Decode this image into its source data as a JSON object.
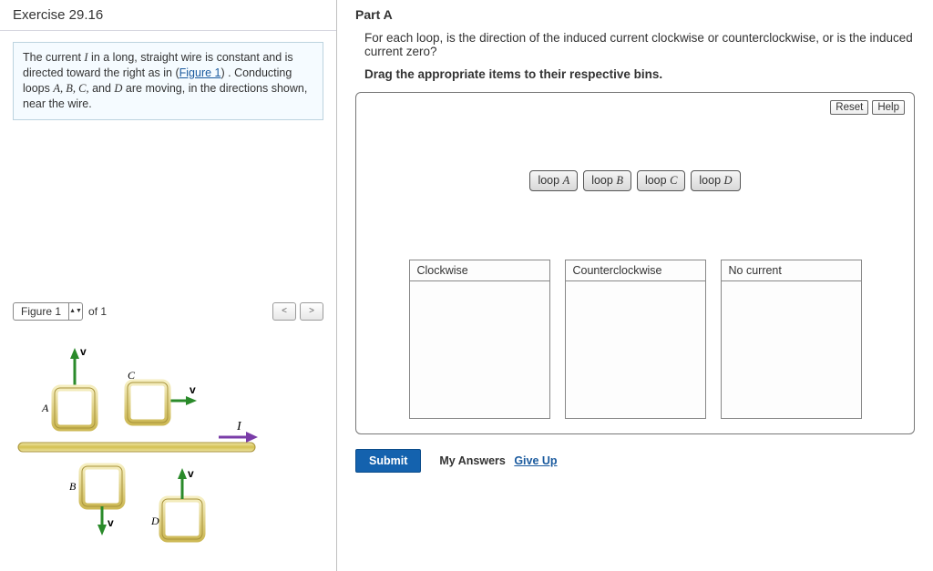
{
  "exercise": {
    "title": "Exercise 29.16",
    "description_prefix": "The current ",
    "description_var": "I",
    "description_mid1": " in a long, straight wire is constant and is directed toward the right as in (",
    "figure_link": "Figure 1",
    "description_mid2": ") . Conducting loops ",
    "loops": "A, B, C,",
    "and": " and ",
    "loopD": "D",
    "description_end": " are moving, in the directions shown, near the wire."
  },
  "figure": {
    "selector_label": "Figure 1",
    "of_text": "of 1",
    "labels": {
      "A": "A",
      "B": "B",
      "C": "C",
      "D": "D",
      "I": "I",
      "v": "v"
    }
  },
  "partA": {
    "header": "Part A",
    "question": "For each loop, is the direction of the induced current clockwise or counterclockwise, or is the induced current zero?",
    "instruction": "Drag the appropriate items to their respective bins.",
    "reset": "Reset",
    "help": "Help",
    "items": [
      {
        "prefix": "loop ",
        "letter": "A"
      },
      {
        "prefix": "loop ",
        "letter": "B"
      },
      {
        "prefix": "loop ",
        "letter": "C"
      },
      {
        "prefix": "loop ",
        "letter": "D"
      }
    ],
    "bins": [
      {
        "label": "Clockwise"
      },
      {
        "label": "Counterclockwise"
      },
      {
        "label": "No current"
      }
    ],
    "submit": "Submit",
    "my_answers": "My Answers",
    "give_up": "Give Up"
  }
}
